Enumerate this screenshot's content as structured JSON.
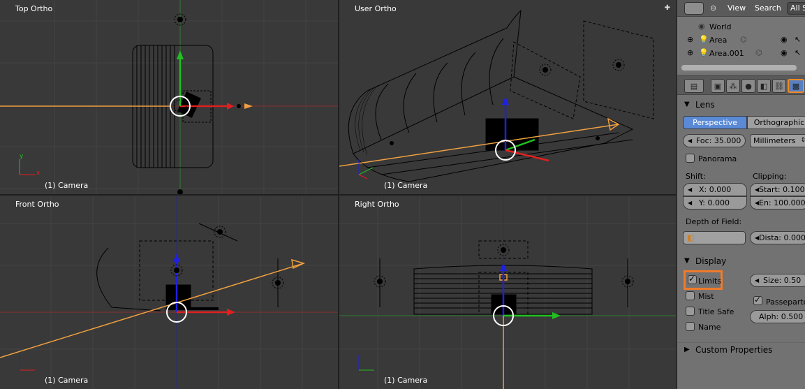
{
  "viewports": [
    {
      "id": "top",
      "title": "Top Ortho",
      "footer": "(1) Camera"
    },
    {
      "id": "user",
      "title": "User Ortho",
      "footer": "(1) Camera"
    },
    {
      "id": "front",
      "title": "Front Ortho",
      "footer": "(1) Camera"
    },
    {
      "id": "right",
      "title": "Right Ortho",
      "footer": "(1) Camera"
    }
  ],
  "outliner": {
    "view_menu": "View",
    "search_menu": "Search",
    "filter_dropdown": "All S",
    "items": [
      {
        "label": "World"
      },
      {
        "label": "Area"
      },
      {
        "label": "Area.001"
      }
    ]
  },
  "properties": {
    "lens": {
      "title": "Lens",
      "perspective": "Perspective",
      "orthographic": "Orthographic",
      "focal": "Foc: 35.000",
      "units": "Millimeters",
      "panorama": "Panorama",
      "shift_label": "Shift:",
      "clipping_label": "Clipping:",
      "shift_x": "X: 0.000",
      "shift_y": "Y: 0.000",
      "clip_start": "Start: 0.100",
      "clip_end": "En: 100.000",
      "dof_label": "Depth of Field:",
      "distance": "Dista: 0.000"
    },
    "display": {
      "title": "Display",
      "limits": "Limits",
      "size": "Size: 0.50",
      "mist": "Mist",
      "passepartout": "Passepartout",
      "title_safe": "Title Safe",
      "alpha": "Alph: 0.500",
      "name": "Name",
      "limits_checked": true,
      "mist_checked": false,
      "title_safe_checked": false,
      "name_checked": false,
      "passepartout_checked": true
    },
    "custom_properties": "Custom Properties"
  },
  "colors": {
    "highlight": "#f07b2a",
    "active_blue": "#5a8ad6",
    "axis_x": "#e02020",
    "axis_y": "#20c020",
    "axis_z": "#2020e0",
    "camera_line": "#f0a040"
  }
}
